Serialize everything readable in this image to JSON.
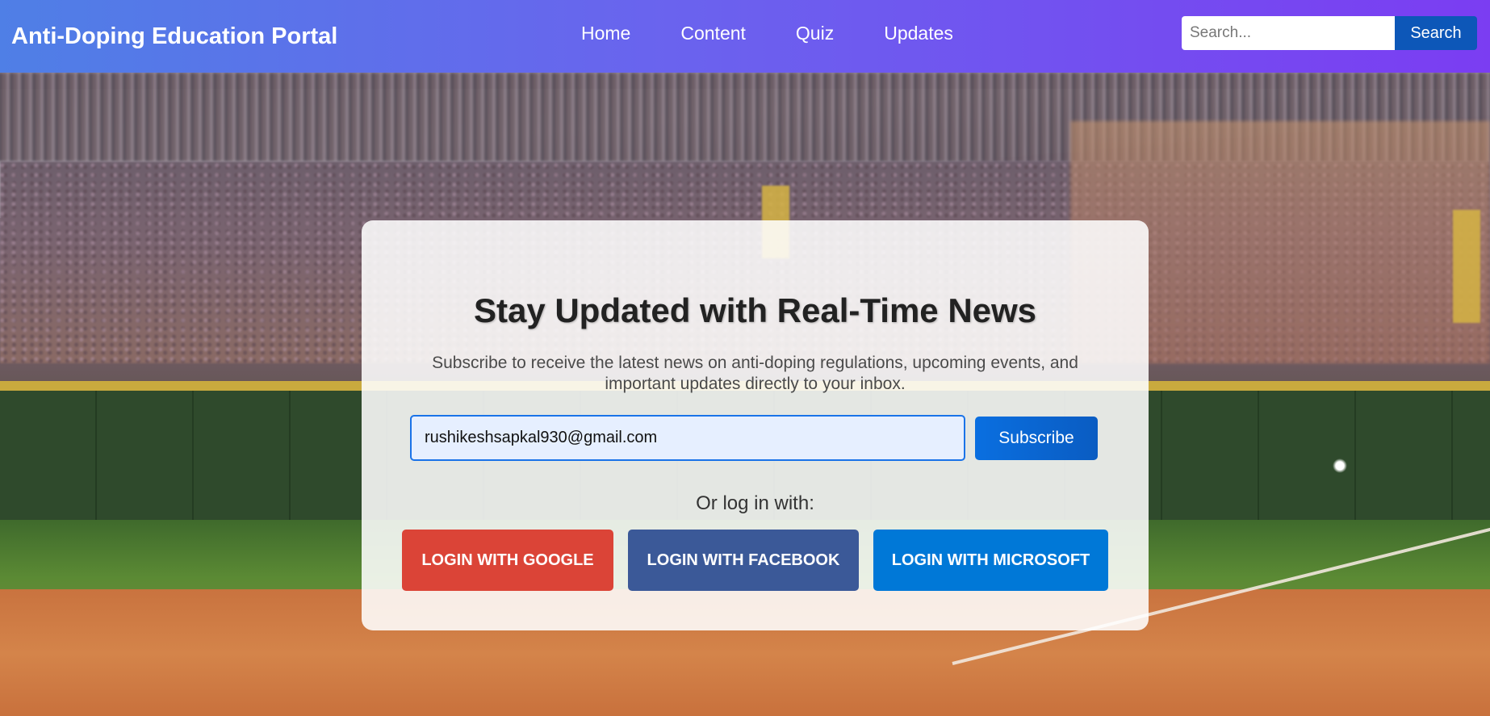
{
  "header": {
    "title": "Anti-Doping Education Portal",
    "nav": [
      "Home",
      "Content",
      "Quiz",
      "Updates"
    ],
    "search_placeholder": "Search...",
    "search_button": "Search"
  },
  "card": {
    "heading": "Stay Updated with Real-Time News",
    "description": "Subscribe to receive the latest news on anti-doping regulations, upcoming events, and important updates directly to your inbox.",
    "email_value": "rushikeshsapkal930@gmail.com",
    "subscribe_button": "Subscribe",
    "or_text": "Or log in with:",
    "social": {
      "google": "LOGIN WITH GOOGLE",
      "facebook": "LOGIN WITH FACEBOOK",
      "microsoft": "LOGIN WITH MICROSOFT"
    }
  },
  "colors": {
    "header_gradient_start": "#4f7fe6",
    "header_gradient_end": "#7b3df2",
    "search_button": "#0d57b8",
    "subscribe_button": "#0a6fe0",
    "google": "#db4437",
    "facebook": "#3b5998",
    "microsoft": "#0078d7"
  }
}
